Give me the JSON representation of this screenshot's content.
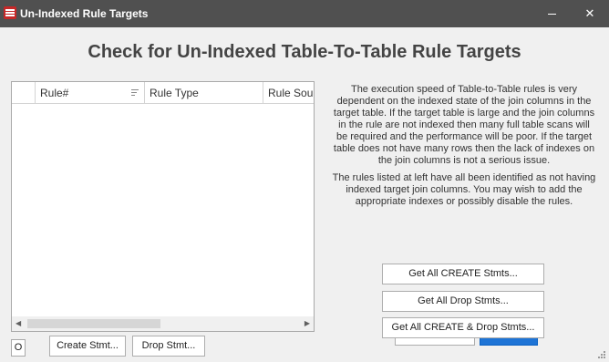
{
  "window": {
    "title": "Un-Indexed Rule Targets",
    "minimize_glyph": "",
    "close_glyph": "✕"
  },
  "heading": "Check for Un-Indexed Table-To-Table  Rule Targets",
  "grid": {
    "columns": [
      "Rule#",
      "Rule Type",
      "Rule Sourc"
    ],
    "rows": []
  },
  "description": {
    "paragraph1": "The execution speed of Table-to-Table rules is very dependent on the indexed state of the join columns in the target table. If the target table is large and the join columns in the rule are not indexed then many full table scans will be required and the performance will be poor. If the target table does not have many rows then the lack of indexes on the join columns is not a serious issue.",
    "paragraph2": "The rules listed at left have all been identified as not having indexed target join columns. You may wish to add the appropriate indexes or possibly disable the rules."
  },
  "buttons": {
    "get_all_create": "Get All CREATE Stmts...",
    "get_all_drop": "Get All Drop Stmts...",
    "get_all_create_drop": "Get All CREATE & Drop Stmts...",
    "create_stmt": "Create Stmt...",
    "drop_stmt": "Drop Stmt..."
  },
  "count_box": "O",
  "colors": {
    "titlebar": "#505050",
    "window_bg": "#f0f0f0",
    "accent_blue": "#1e74d6",
    "app_icon": "#c62828"
  }
}
